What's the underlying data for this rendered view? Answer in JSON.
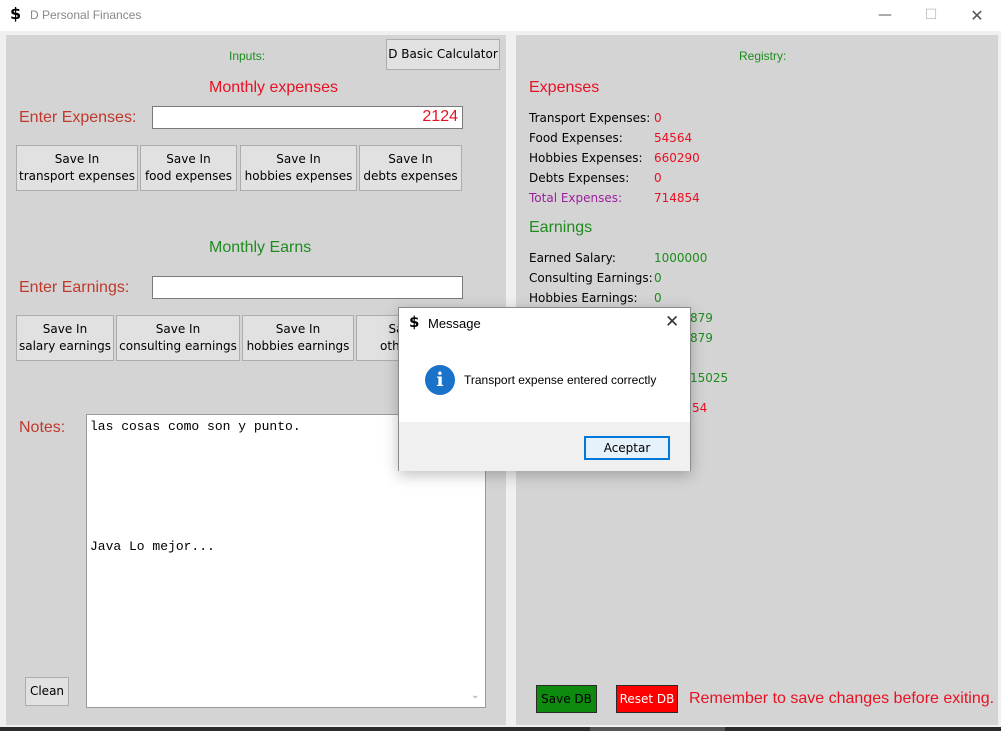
{
  "window": {
    "icon": "$",
    "title": "D Personal Finances",
    "controls": {
      "minimize": "—",
      "maximize": "☐",
      "close": "✕"
    }
  },
  "left": {
    "inputs_label": "Inputs:",
    "calculator_button": "D Basic Calculator",
    "expenses_heading": "Monthly expenses",
    "expenses_label": "Enter Expenses:",
    "expenses_value": "2124",
    "expense_buttons": [
      {
        "line1": "Save In",
        "line2": "transport expenses"
      },
      {
        "line1": "Save In",
        "line2": "food expenses"
      },
      {
        "line1": "Save In",
        "line2": "hobbies expenses"
      },
      {
        "line1": "Save In",
        "line2": "debts expenses"
      }
    ],
    "earns_heading": "Monthly Earns",
    "earnings_label": "Enter Earnings:",
    "earnings_value": "",
    "earning_buttons": [
      {
        "line1": "Save In",
        "line2": "salary earnings"
      },
      {
        "line1": "Save In",
        "line2": "consulting earnings"
      },
      {
        "line1": "Save In",
        "line2": "hobbies earnings"
      },
      {
        "line1": "Sa",
        "line2": "other"
      }
    ],
    "notes_label": "Notes:",
    "notes_text": "las cosas como son y punto.\n\n\n\n\n\n\nJava Lo mejor...",
    "clean_button": "Clean"
  },
  "right": {
    "registry_label": "Registry:",
    "expenses_heading": "Expenses",
    "expense_rows": [
      {
        "label": "Transport Expenses:",
        "value": "0"
      },
      {
        "label": "Food Expenses:",
        "value": "54564"
      },
      {
        "label": "Hobbies Expenses:",
        "value": "660290"
      },
      {
        "label": "Debts Expenses:",
        "value": "0"
      }
    ],
    "total_expenses": {
      "label": "Total Expenses:",
      "value": "714854"
    },
    "earnings_heading": "Earnings",
    "earning_rows": [
      {
        "label": "Earned Salary:",
        "value": "1000000"
      },
      {
        "label": "Consulting Earnings:",
        "value": "0"
      },
      {
        "label": "Hobbies Earnings:",
        "value": "0"
      }
    ],
    "hidden_partial_values": [
      "879",
      "879",
      "15025",
      "54"
    ],
    "save_db_button": "Save DB",
    "reset_db_button": "Reset DB",
    "reminder": "Remember to save changes before exiting."
  },
  "dialog": {
    "icon": "$",
    "title": "Message",
    "close": "✕",
    "info_icon_glyph": "i",
    "message": "Transport expense entered correctly",
    "ok_button": "Aceptar"
  },
  "colors": {
    "panel_bg": "#d4d4d4",
    "green": "#1e8c1e",
    "red": "#e81123",
    "purple": "#9b1f9b",
    "save_db_bg": "#0e8a0e",
    "reset_db_bg": "#ff0000",
    "info_blue": "#1a73c9"
  }
}
